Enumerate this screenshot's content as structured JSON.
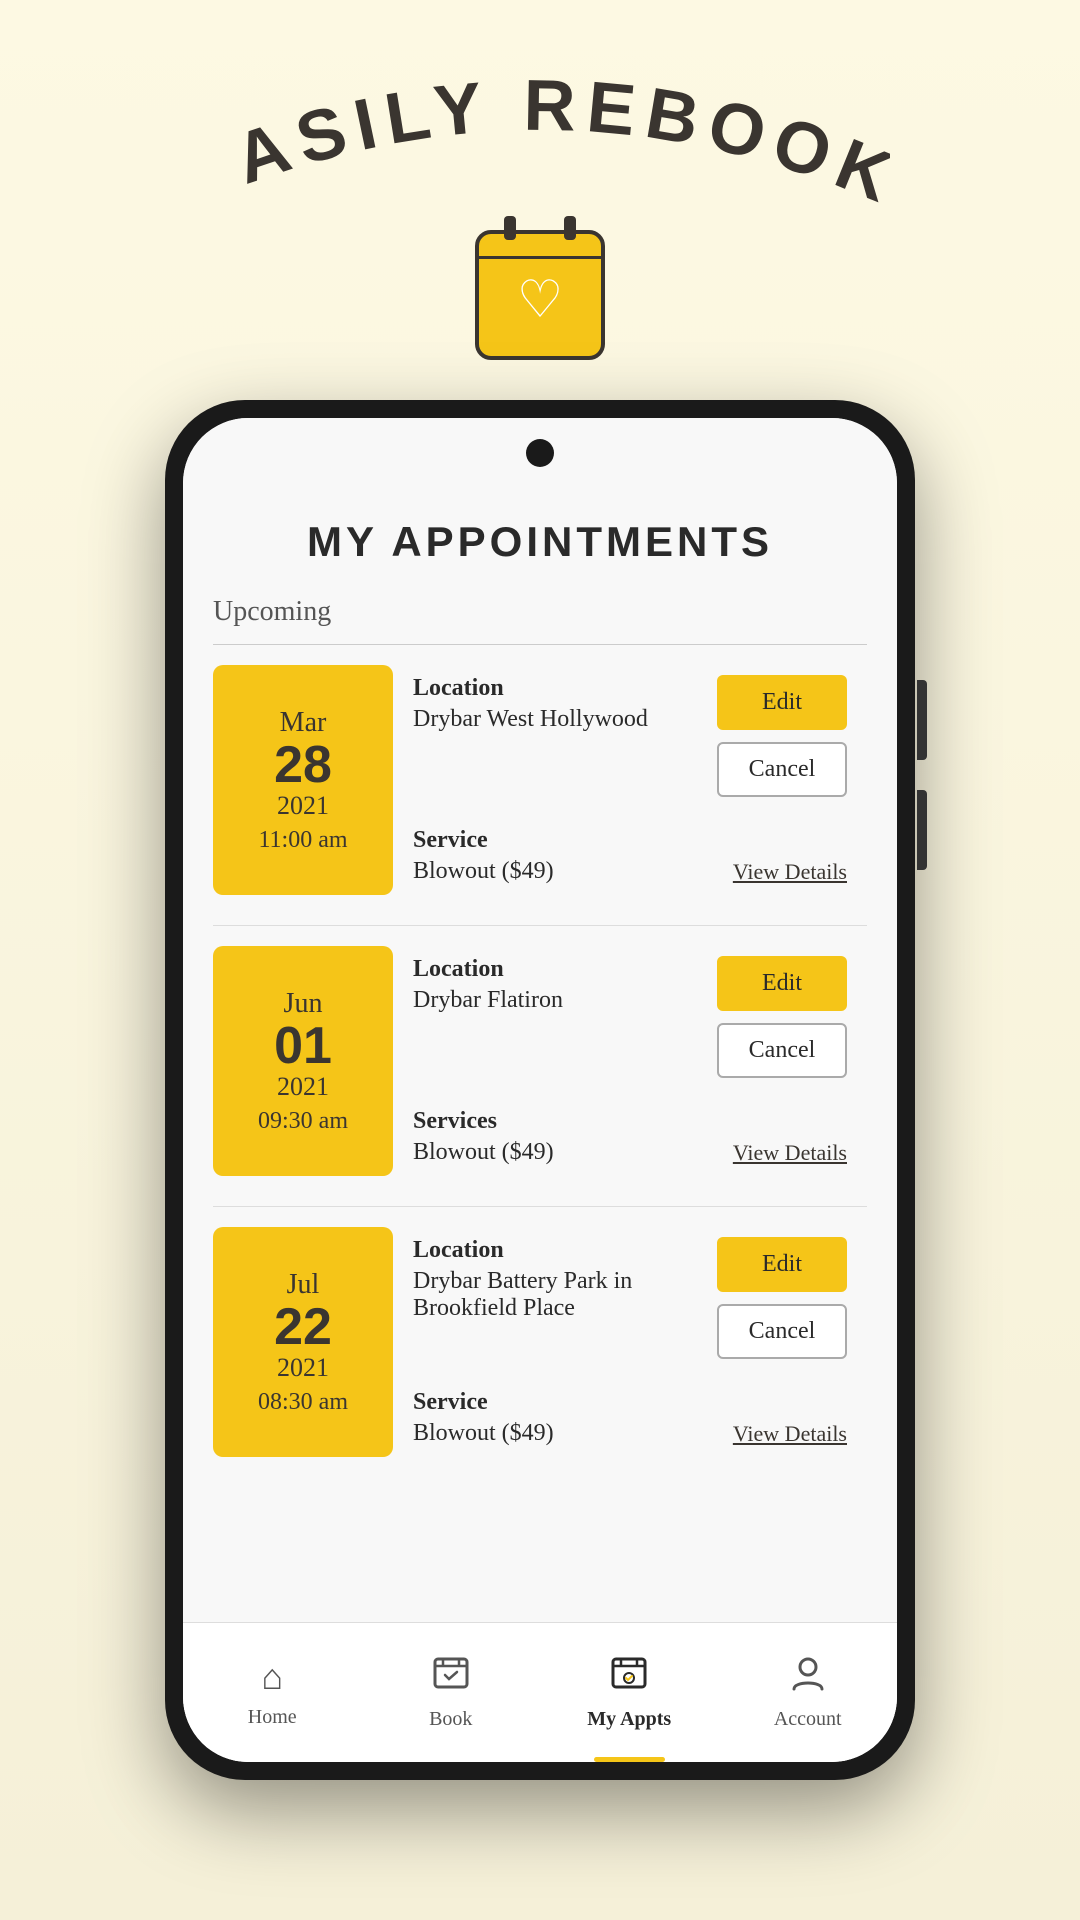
{
  "header": {
    "title": "EASILY REBOOK",
    "arc_text": "EASILY REBOOK"
  },
  "screen": {
    "title": "MY APPOINTMENTS",
    "section_label": "Upcoming",
    "appointments": [
      {
        "id": 1,
        "month": "Mar",
        "day": "28",
        "year": "2021",
        "time": "11:00 am",
        "location_label": "Location",
        "location": "Drybar West Hollywood",
        "service_label": "Service",
        "service": "Blowout ($49)",
        "edit_label": "Edit",
        "cancel_label": "Cancel",
        "view_details_label": "View Details"
      },
      {
        "id": 2,
        "month": "Jun",
        "day": "01",
        "year": "2021",
        "time": "09:30 am",
        "location_label": "Location",
        "location": "Drybar Flatiron",
        "service_label": "Services",
        "service": "Blowout ($49)",
        "edit_label": "Edit",
        "cancel_label": "Cancel",
        "view_details_label": "View Details"
      },
      {
        "id": 3,
        "month": "Jul",
        "day": "22",
        "year": "2021",
        "time": "08:30 am",
        "location_label": "Location",
        "location": "Drybar Battery Park in Brookfield Place",
        "service_label": "Service",
        "service": "Blowout ($49)",
        "edit_label": "Edit",
        "cancel_label": "Cancel",
        "view_details_label": "View Details"
      }
    ]
  },
  "nav": {
    "items": [
      {
        "id": "home",
        "label": "Home",
        "icon": "home",
        "active": false
      },
      {
        "id": "book",
        "label": "Book",
        "icon": "book",
        "active": false
      },
      {
        "id": "my-appts",
        "label": "My Appts",
        "icon": "my-appts",
        "active": true
      },
      {
        "id": "account",
        "label": "Account",
        "icon": "account",
        "active": false
      }
    ]
  },
  "colors": {
    "yellow": "#f5c518",
    "dark": "#3a3530",
    "bg": "#fdf9e3"
  }
}
